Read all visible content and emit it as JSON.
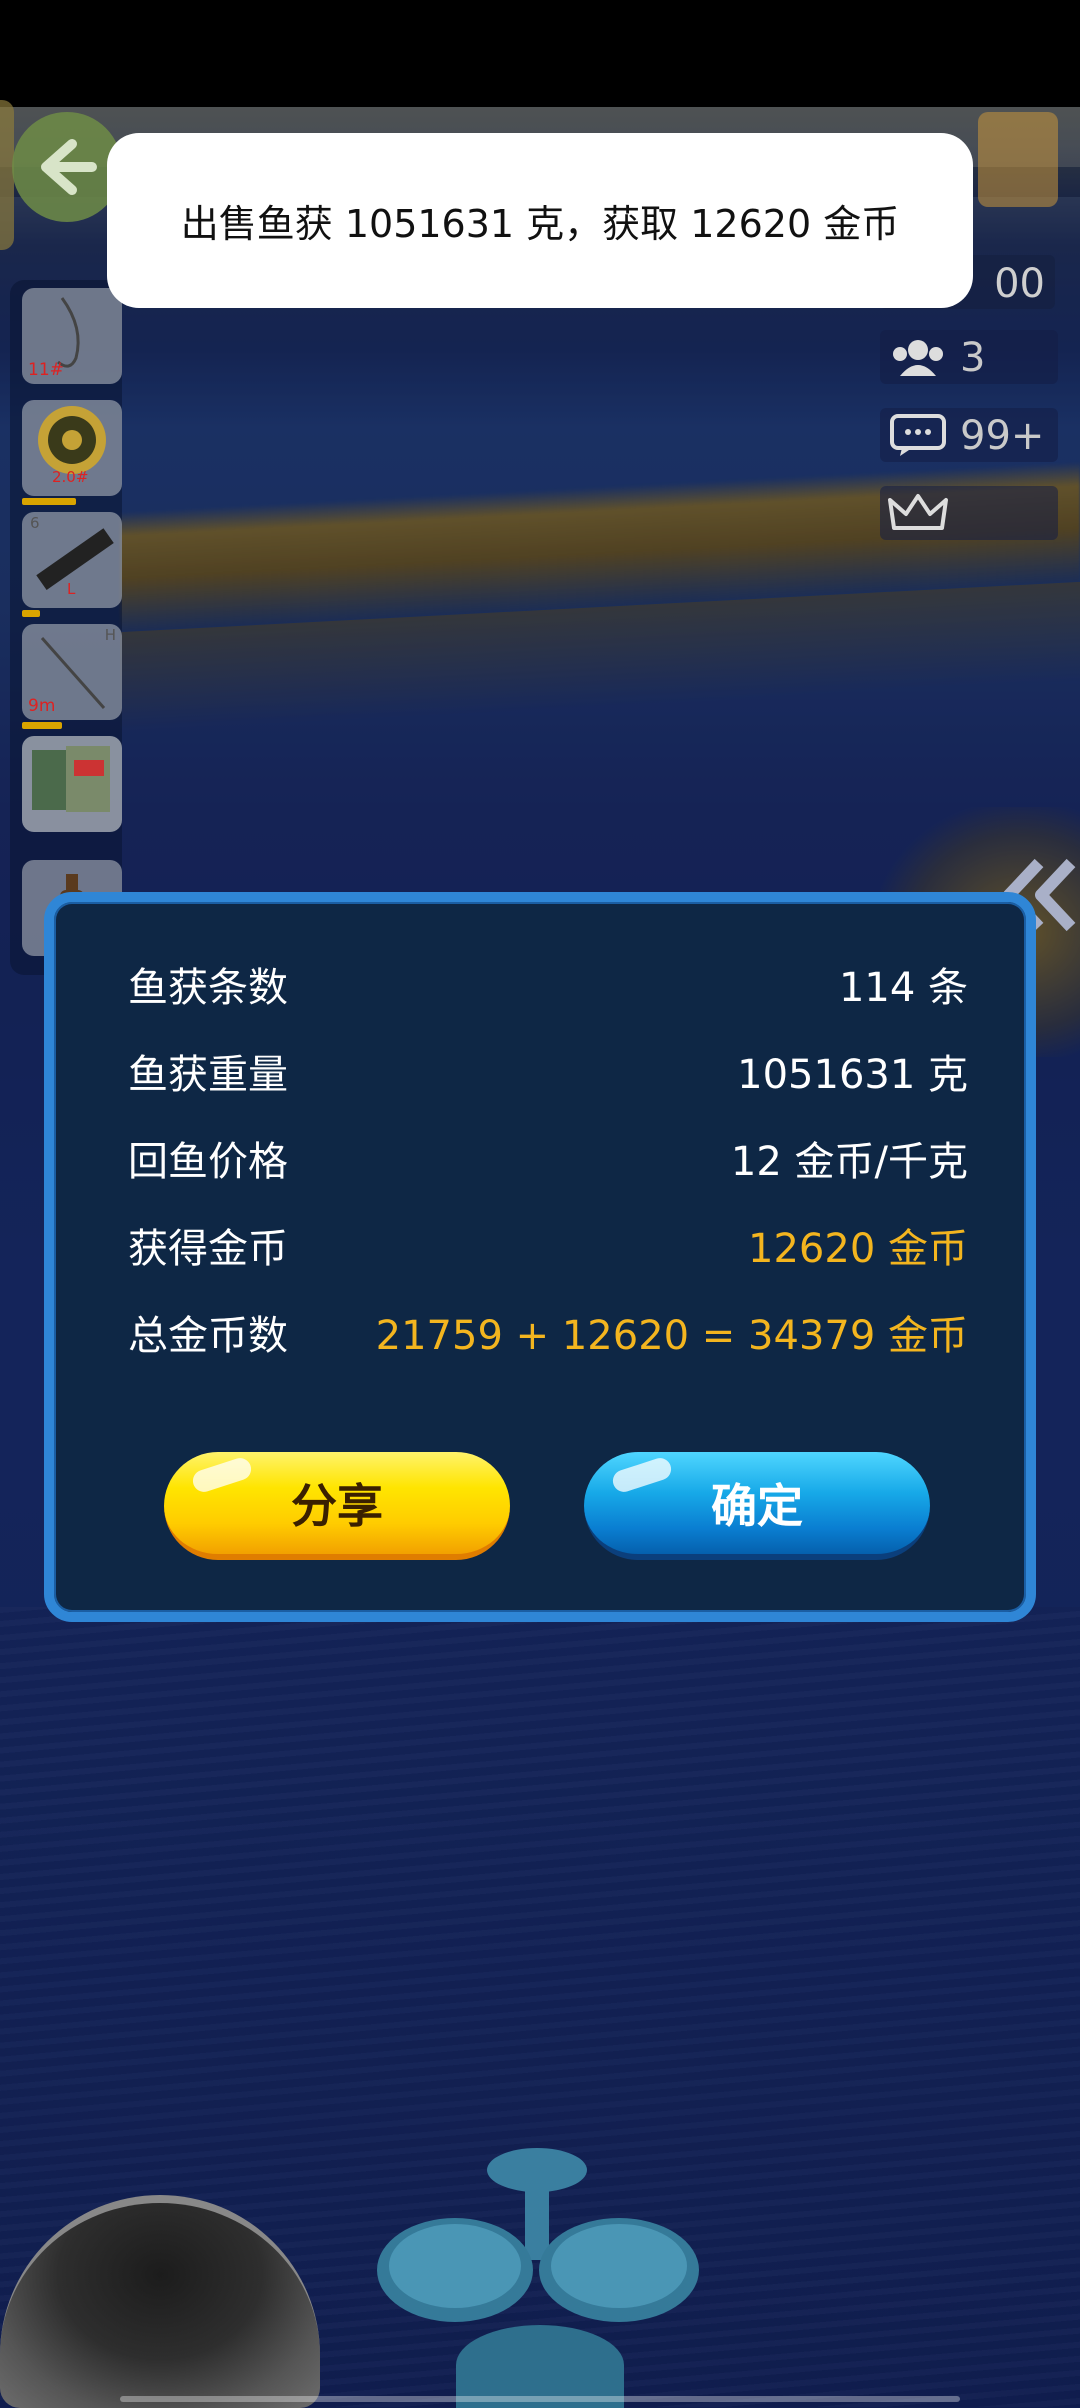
{
  "toast": {
    "message": "出售鱼获 1051631 克，获取 12620 金币"
  },
  "tools": [
    {
      "name": "hook",
      "label": "11#"
    },
    {
      "name": "line-spool",
      "label": "2.0#"
    },
    {
      "name": "rod-case",
      "corner": "6",
      "label": "L"
    },
    {
      "name": "rod",
      "corner": "H",
      "label": "9m"
    },
    {
      "name": "bait-pack"
    },
    {
      "name": "bottle"
    }
  ],
  "status": {
    "coins_partial": "00",
    "friends_count": "3",
    "messages_count": "99+"
  },
  "dialog": {
    "rows": [
      {
        "label": "鱼获条数",
        "value": "114 条"
      },
      {
        "label": "鱼获重量",
        "value": "1051631 克"
      },
      {
        "label": "回鱼价格",
        "value": "12 金币/千克"
      },
      {
        "label": "获得金币",
        "value": "12620 金币"
      },
      {
        "label": "总金币数",
        "value": "21759 + 12620 = 34379 金币"
      }
    ],
    "share_label": "分享",
    "ok_label": "确定"
  },
  "colors": {
    "dialog_bg": "#0e2745",
    "dialog_border": "#2f86d6",
    "gold_text": "#f3b51f",
    "share_button": "#ffe500",
    "ok_button": "#17a9e8"
  }
}
